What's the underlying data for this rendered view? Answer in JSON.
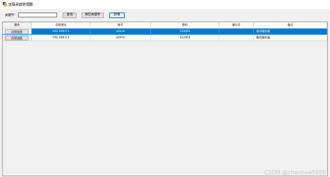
{
  "window": {
    "title": "远程桌面管理器"
  },
  "toolbar": {
    "keyword_label": "关键字:",
    "keyword_value": "",
    "query_label": "查询",
    "clear_label": "清空关键字",
    "new_label": "新增"
  },
  "table": {
    "columns": [
      "操作",
      "远程地址",
      "账号",
      "密码",
      "端口号",
      "备注"
    ],
    "rows": [
      {
        "action": "远程连接",
        "address": "192.168.0.1",
        "account": "admin",
        "password": "123456",
        "port": "",
        "note": "测试服务器",
        "selected": true
      },
      {
        "action": "远程连接",
        "address": "192.168.0.2",
        "account": "admin",
        "password": "123456",
        "port": "",
        "note": "备用服务器",
        "selected": false
      }
    ]
  },
  "watermark": "CSDN @chenhua5689"
}
